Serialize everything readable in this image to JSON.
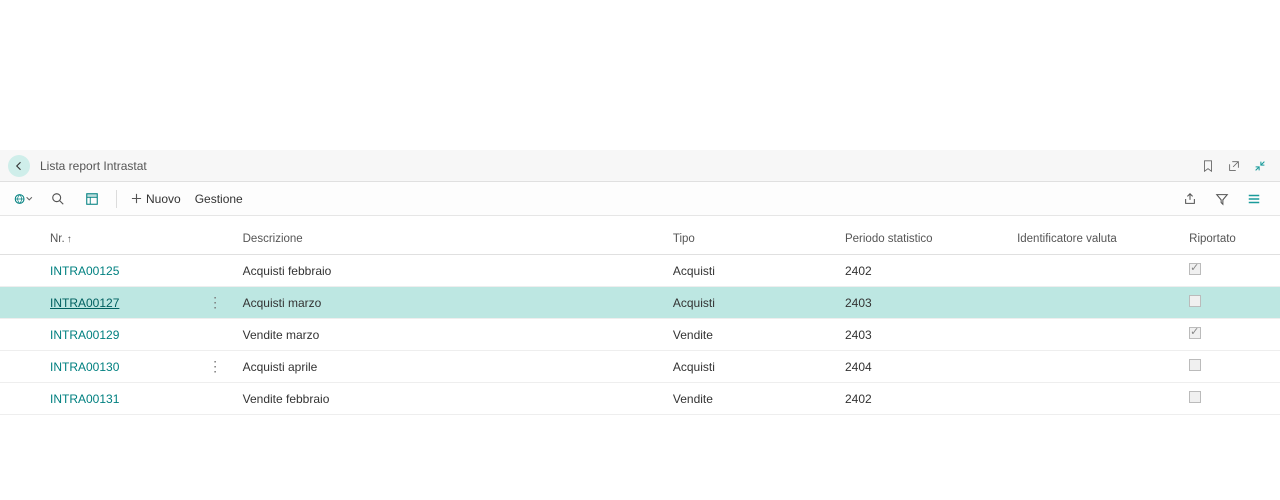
{
  "titlebar": {
    "title": "Lista report Intrastat"
  },
  "toolbar": {
    "new_label": "Nuovo",
    "manage_label": "Gestione"
  },
  "table": {
    "headers": {
      "nr": "Nr.",
      "descrizione": "Descrizione",
      "tipo": "Tipo",
      "periodo": "Periodo statistico",
      "identificatore": "Identificatore valuta",
      "riportato": "Riportato"
    },
    "rows": [
      {
        "nr": "INTRA00125",
        "descrizione": "Acquisti febbraio",
        "tipo": "Acquisti",
        "periodo": "2402",
        "identificatore": "",
        "riportato_checked": true,
        "selected": false,
        "showdots": false
      },
      {
        "nr": "INTRA00127",
        "descrizione": "Acquisti marzo",
        "tipo": "Acquisti",
        "periodo": "2403",
        "identificatore": "",
        "riportato_checked": false,
        "selected": true,
        "showdots": true
      },
      {
        "nr": "INTRA00129",
        "descrizione": "Vendite marzo",
        "tipo": "Vendite",
        "periodo": "2403",
        "identificatore": "",
        "riportato_checked": true,
        "selected": false,
        "showdots": false
      },
      {
        "nr": "INTRA00130",
        "descrizione": "Acquisti aprile",
        "tipo": "Acquisti",
        "periodo": "2404",
        "identificatore": "",
        "riportato_checked": false,
        "selected": false,
        "showdots": true
      },
      {
        "nr": "INTRA00131",
        "descrizione": "Vendite febbraio",
        "tipo": "Vendite",
        "periodo": "2402",
        "identificatore": "",
        "riportato_checked": false,
        "selected": false,
        "showdots": false
      }
    ]
  }
}
